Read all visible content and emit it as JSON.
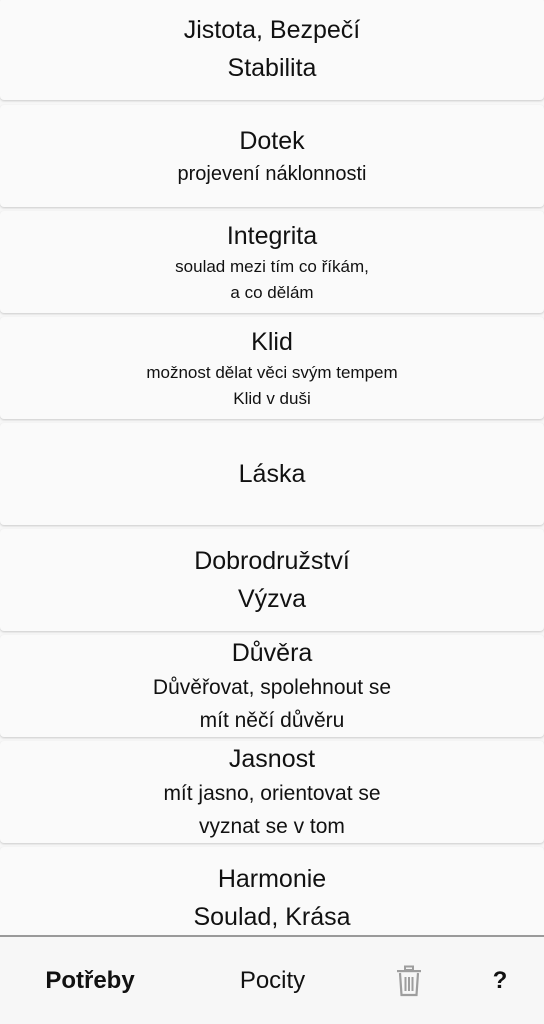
{
  "cards": [
    {
      "title": "Jistota, Bezpečí",
      "subtitle": "Stabilita"
    },
    {
      "title": "Dotek",
      "subtitle": "projevení náklonnosti"
    },
    {
      "title": "Integrita",
      "line1": "soulad mezi tím co říkám,",
      "line2": "a co dělám"
    },
    {
      "title": "Klid",
      "line1": "možnost dělat věci svým tempem",
      "line2": "Klid v duši"
    },
    {
      "title": "Láska"
    },
    {
      "title": "Dobrodružství",
      "subtitle": "Výzva"
    },
    {
      "title": "Důvěra",
      "line1": "Důvěřovat, spolehnout se",
      "line2": "mít něčí důvěru"
    },
    {
      "title": "Jasnost",
      "line1": "mít jasno, orientovat se",
      "line2": "vyznat se v tom"
    },
    {
      "title": "Harmonie",
      "subtitle": "Soulad, Krása"
    }
  ],
  "bottom_bar": {
    "tab_needs": "Potřeby",
    "tab_feelings": "Pocity",
    "trash_icon": "trash-icon",
    "help_label": "?"
  }
}
